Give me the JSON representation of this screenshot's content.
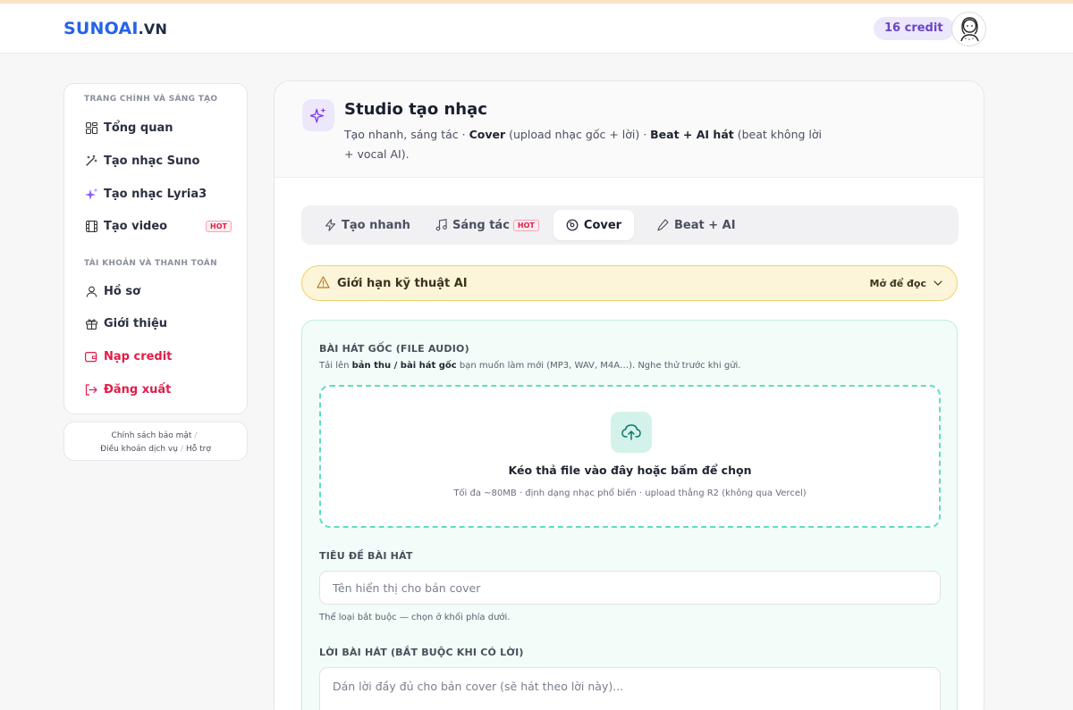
{
  "brand": {
    "part1": "SUNOAI",
    "part2": ".VN"
  },
  "header": {
    "credit": "16 credit"
  },
  "sidebar": {
    "section1": "TRANG CHÍNH VÀ SÁNG TẠO",
    "items1": [
      {
        "label": "Tổng quan",
        "icon": "dashboard-icon"
      },
      {
        "label": "Tạo nhạc Suno",
        "icon": "magic-wand-icon"
      },
      {
        "label": "Tạo nhạc Lyria3",
        "icon": "sparkles-icon"
      },
      {
        "label": "Tạo video",
        "icon": "film-icon",
        "badge": "HOT"
      }
    ],
    "section2": "TÀI KHOẢN VÀ THANH TOÁN",
    "items2": [
      {
        "label": "Hồ sơ",
        "icon": "user-icon"
      },
      {
        "label": "Giới thiệu",
        "icon": "gift-icon"
      },
      {
        "label": "Nạp credit",
        "icon": "wallet-icon"
      },
      {
        "label": "Đăng xuất",
        "icon": "logout-icon"
      }
    ]
  },
  "footer_links": {
    "privacy": "Chính sách bảo mật",
    "terms": "Điều khoản dịch vụ",
    "support": "Hỗ trợ",
    "sep": "/"
  },
  "studio": {
    "title": "Studio tạo nhạc",
    "sub_a": "Tạo nhanh, sáng tác · ",
    "sub_b": "Cover",
    "sub_c": " (upload nhạc gốc + lời) · ",
    "sub_d": "Beat + AI hát",
    "sub_e": " (beat không lời + vocal AI)."
  },
  "tabs": [
    {
      "label": "Tạo nhanh",
      "icon": "bolt-icon"
    },
    {
      "label": "Sáng tác",
      "icon": "music-note-icon",
      "badge": "HOT"
    },
    {
      "label": "Cover",
      "icon": "disc-icon",
      "active": true
    },
    {
      "label": "Beat + AI",
      "icon": "pen-icon"
    }
  ],
  "warning": {
    "title": "Giới hạn kỹ thuật AI",
    "action": "Mở để đọc"
  },
  "form": {
    "audio_label": "BÀI HÁT GỐC (FILE AUDIO)",
    "audio_hint_a": "Tải lên ",
    "audio_hint_b": "bản thu / bài hát gốc",
    "audio_hint_c": " bạn muốn làm mới (MP3, WAV, M4A…). Nghe thử trước khi gửi.",
    "drop_title": "Kéo thả file vào đây hoặc bấm để chọn",
    "drop_sub": "Tối đa ~80MB · định dạng nhạc phổ biến · upload thẳng R2 (không qua Vercel)",
    "title_label": "TIÊU ĐỀ BÀI HÁT",
    "title_placeholder": "Tên hiển thị cho bản cover",
    "title_value": "",
    "genre_hint": "Thể loại bắt buộc — chọn ở khối phía dưới.",
    "lyrics_label": "LỜI BÀI HÁT (BẮT BUỘC KHI CÓ LỜI)",
    "lyrics_placeholder": "Dán lời đầy đủ cho bản cover (sẽ hát theo lời này)...",
    "lyrics_value": ""
  },
  "colors": {
    "brand_blue": "#2563eb",
    "accent_purple": "#6b46c1",
    "danger": "#e11d48",
    "teal": "#63dcc0",
    "warn_bg": "#fdf5d9"
  }
}
